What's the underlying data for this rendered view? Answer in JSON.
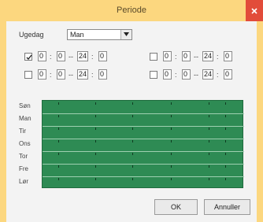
{
  "window": {
    "title": "Periode",
    "close_label": "x"
  },
  "weekday": {
    "label": "Ugedag",
    "selected": "Man"
  },
  "time_rows": [
    {
      "checked": true,
      "start_h": "0",
      "start_m": "0",
      "end_h": "24",
      "end_m": "0"
    },
    {
      "checked": false,
      "start_h": "0",
      "start_m": "0",
      "end_h": "24",
      "end_m": "0"
    },
    {
      "checked": false,
      "start_h": "0",
      "start_m": "0",
      "end_h": "24",
      "end_m": "0"
    },
    {
      "checked": false,
      "start_h": "0",
      "start_m": "0",
      "end_h": "24",
      "end_m": "0"
    }
  ],
  "separators": {
    "colon": ":",
    "dash": "--"
  },
  "schedule": {
    "days": [
      "Søn",
      "Man",
      "Tir",
      "Ons",
      "Tor",
      "Fre",
      "Lør"
    ],
    "fill_color": "#2e8b54"
  },
  "buttons": {
    "ok": "OK",
    "cancel": "Annuller"
  }
}
